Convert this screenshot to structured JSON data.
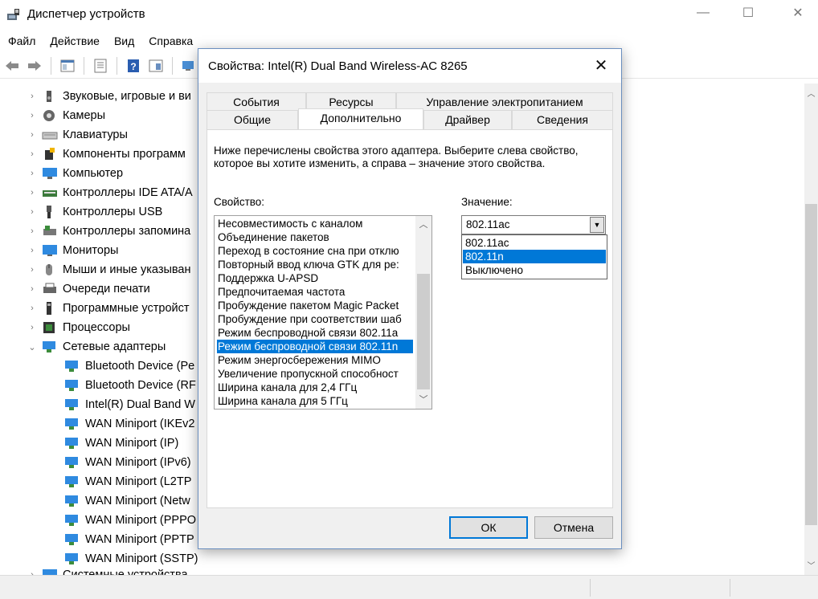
{
  "app": {
    "title": "Диспетчер устройств",
    "menu": [
      "Файл",
      "Действие",
      "Вид",
      "Справка"
    ]
  },
  "window_controls": {
    "minimize": "—",
    "maximize": "☐",
    "close": "✕"
  },
  "tree": {
    "categories": [
      {
        "label": "Звуковые, игровые и ви",
        "icon": "speaker-icon",
        "state": "collapsed"
      },
      {
        "label": "Камеры",
        "icon": "camera-icon",
        "state": "collapsed"
      },
      {
        "label": "Клавиатуры",
        "icon": "keyboard-icon",
        "state": "collapsed"
      },
      {
        "label": "Компоненты программ",
        "icon": "software-component-icon",
        "state": "collapsed"
      },
      {
        "label": "Компьютер",
        "icon": "computer-icon",
        "state": "collapsed"
      },
      {
        "label": "Контроллеры IDE ATA/A",
        "icon": "ide-controller-icon",
        "state": "collapsed"
      },
      {
        "label": "Контроллеры USB",
        "icon": "usb-icon",
        "state": "collapsed"
      },
      {
        "label": "Контроллеры запомина",
        "icon": "storage-controller-icon",
        "state": "collapsed"
      },
      {
        "label": "Мониторы",
        "icon": "monitor-icon",
        "state": "collapsed"
      },
      {
        "label": "Мыши и иные указыван",
        "icon": "mouse-icon",
        "state": "collapsed"
      },
      {
        "label": "Очереди печати",
        "icon": "printer-icon",
        "state": "collapsed"
      },
      {
        "label": "Программные устройст",
        "icon": "software-device-icon",
        "state": "collapsed"
      },
      {
        "label": "Процессоры",
        "icon": "processor-icon",
        "state": "collapsed"
      },
      {
        "label": "Сетевые адаптеры",
        "icon": "network-adapter-icon",
        "state": "expanded"
      }
    ],
    "network_children": [
      "Bluetooth Device (Pe",
      "Bluetooth Device (RF",
      "Intel(R) Dual Band W",
      "WAN Miniport (IKEv2",
      "WAN Miniport (IP)",
      "WAN Miniport (IPv6)",
      "WAN Miniport (L2TP",
      "WAN Miniport (Netw",
      "WAN Miniport (PPPO",
      "WAN Miniport (PPTP",
      "WAN Miniport (SSTP)"
    ],
    "last_category": "Системные устройства"
  },
  "dialog": {
    "title": "Свойства: Intel(R) Dual Band Wireless-AC 8265",
    "close": "✕",
    "tabs_row1": [
      "События",
      "Ресурсы",
      "Управление электропитанием"
    ],
    "tabs_row2": [
      "Общие",
      "Дополнительно",
      "Драйвер",
      "Сведения"
    ],
    "active_tab": "Дополнительно",
    "description": "Ниже перечислены свойства этого адаптера. Выберите слева свойство, которое вы хотите изменить, а справа – значение этого свойства.",
    "property_label": "Свойство:",
    "value_label": "Значение:",
    "properties": [
      "Несовместимость с каналом",
      "Объединение пакетов",
      "Переход в состояние сна при отклю",
      "Повторный ввод ключа GTK для ре:",
      "Поддержка U-APSD",
      "Предпочитаемая частота",
      "Пробуждение пакетом Magic Packet",
      "Пробуждение при соответствии шаб",
      "Режим беспроводной связи 802.11a",
      "Режим беспроводной связи 802.11n",
      "Режим энергосбережения MIMO",
      "Увеличение пропускной способност",
      "Ширина канала для 2,4 ГГц",
      "Ширина канала для 5 ГГц"
    ],
    "selected_property": "Режим беспроводной связи 802.11n",
    "combo_value": "802.11ac",
    "dropdown_options": [
      "802.11ac",
      "802.11n",
      "Выключено"
    ],
    "highlighted_option": "802.11n",
    "ok": "ОК",
    "cancel": "Отмена"
  },
  "colors": {
    "selection": "#0078d7",
    "dialog_bg": "#f0f0f0",
    "dialog_border": "#6b8fbf"
  }
}
